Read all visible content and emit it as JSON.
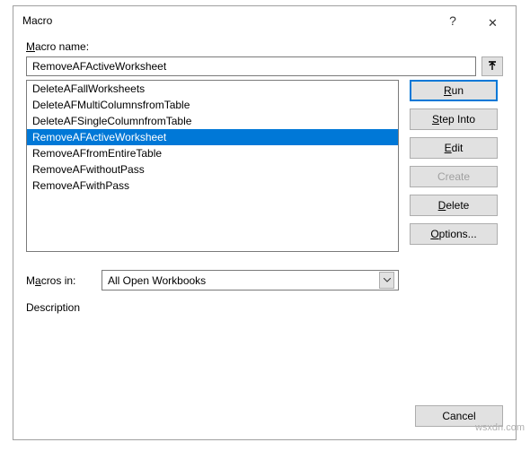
{
  "dialog": {
    "title": "Macro"
  },
  "labels": {
    "macro_name": "Macro name:",
    "macros_in": "Macros in:",
    "description": "Description"
  },
  "input": {
    "value": "RemoveAFActiveWorksheet"
  },
  "list": {
    "items": [
      "DeleteAFallWorksheets",
      "DeleteAFMultiColumnsfromTable",
      "DeleteAFSingleColumnfromTable",
      "RemoveAFActiveWorksheet",
      "RemoveAFfromEntireTable",
      "RemoveAFwithoutPass",
      "RemoveAFwithPass"
    ],
    "selected_index": 3
  },
  "buttons": {
    "run": "Run",
    "step_into": "Step Into",
    "edit": "Edit",
    "create": "Create",
    "delete": "Delete",
    "options": "Options...",
    "cancel": "Cancel"
  },
  "combo": {
    "selected": "All Open Workbooks"
  },
  "watermark": "wsxdn.com"
}
